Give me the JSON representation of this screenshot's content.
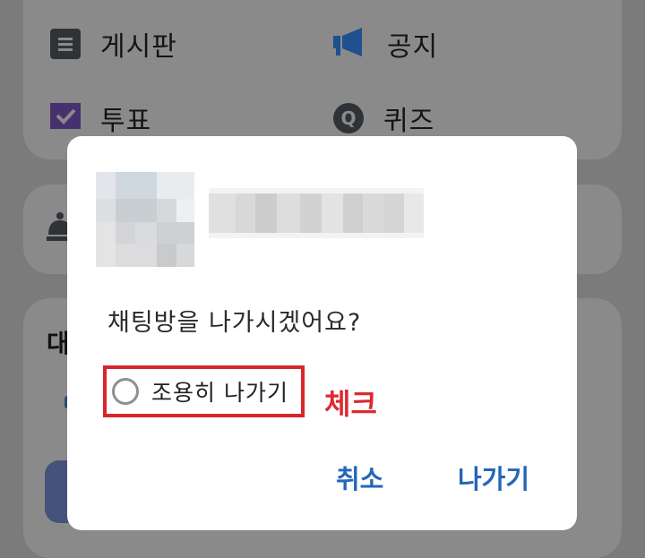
{
  "background": {
    "menu": {
      "board_label": "게시판",
      "notice_label": "공지",
      "vote_label": "투표",
      "quiz_label": "퀴즈",
      "quiz_icon_glyph": "Q"
    },
    "section_heading": "대"
  },
  "dialog": {
    "question": "채팅방을 나가시겠어요?",
    "quiet_option_label": "조용히 나가기",
    "cancel_label": "취소",
    "leave_label": "나가기"
  },
  "annotation": {
    "text": "체크",
    "color": "#dc2a30"
  },
  "colors": {
    "overlay": "#7b7b7b",
    "accent_button": "#2466b8",
    "highlight_box": "#d8262c",
    "vote_icon": "#47306e",
    "notice_icon": "#1f4f8f"
  },
  "icons": {
    "board": "board-icon",
    "notice": "megaphone-icon",
    "vote": "vote-check-icon",
    "quiz": "quiz-icon",
    "bell": "service-bell-icon"
  }
}
